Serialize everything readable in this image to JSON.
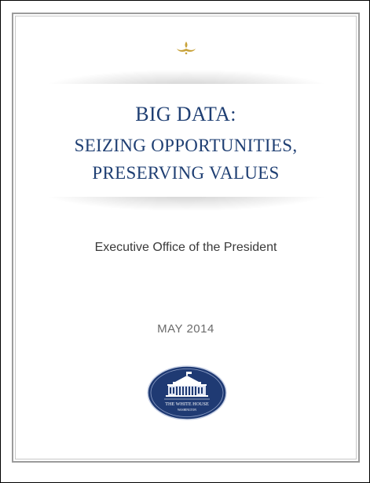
{
  "document": {
    "title_line1": "BIG DATA:",
    "title_line2": "SEIZING OPPORTUNITIES,",
    "title_line3": "PRESERVING VALUES",
    "subtitle": "Executive Office of the President",
    "date": "MAY 2014"
  },
  "seal": {
    "line1": "THE WHITE HOUSE",
    "line2": "WASHINGTON"
  },
  "colors": {
    "title": "#1f3f73",
    "flourish": "#c8a23a",
    "seal_fill": "#1f3a73"
  }
}
